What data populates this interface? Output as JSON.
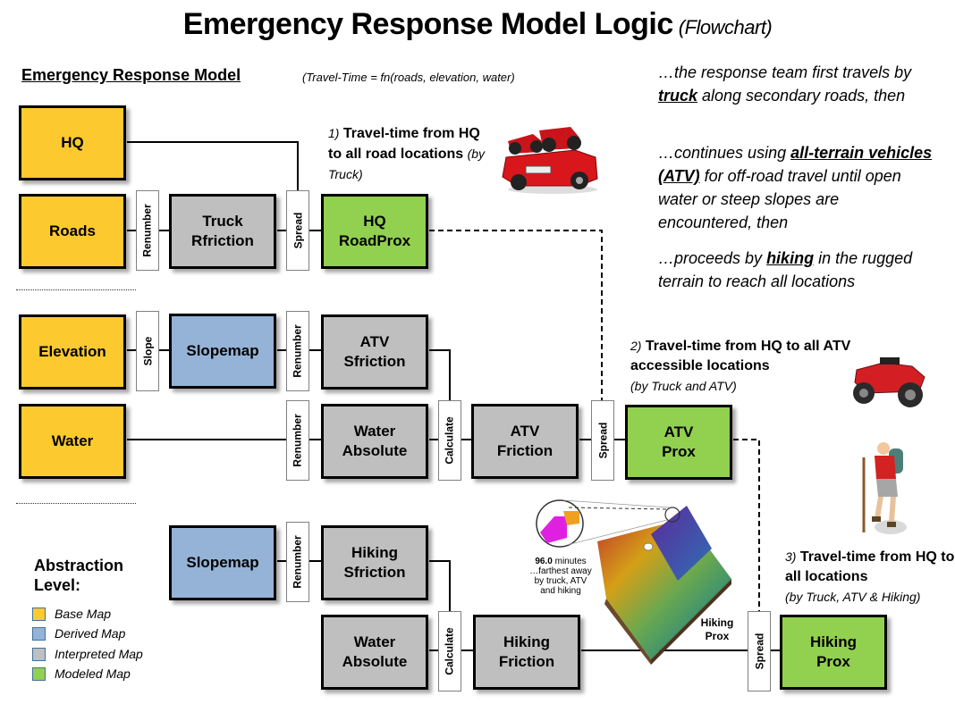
{
  "title": {
    "main": "Emergency Response Model Logic",
    "sub": "(Flowchart)"
  },
  "model": {
    "heading": "Emergency Response Model",
    "formula": "(Travel-Time = fn(roads, elevation, water)"
  },
  "colors": {
    "base": "#fcca2e",
    "derived": "#95b3d7",
    "interpreted": "#bfbfbf",
    "modeled": "#92d050"
  },
  "boxes": {
    "hq": "HQ",
    "roads": "Roads",
    "truck_rfriction": [
      "Truck",
      "Rfriction"
    ],
    "hq_roadprox": [
      "HQ",
      "RoadProx"
    ],
    "elevation": "Elevation",
    "slopemap_atv": "Slopemap",
    "atv_sfriction": [
      "ATV",
      "Sfriction"
    ],
    "water": "Water",
    "water_absolute_atv": [
      "Water",
      "Absolute"
    ],
    "atv_friction": [
      "ATV",
      "Friction"
    ],
    "atv_prox": [
      "ATV",
      "Prox"
    ],
    "slopemap_hiking": "Slopemap",
    "hiking_sfriction": [
      "Hiking",
      "Sfriction"
    ],
    "water_absolute_hiking": [
      "Water",
      "Absolute"
    ],
    "hiking_friction": [
      "Hiking",
      "Friction"
    ],
    "hiking_prox": [
      "Hiking",
      "Prox"
    ]
  },
  "operations": {
    "renumber_roads": "Renumber",
    "spread_truck": "Spread",
    "slope": "Slope",
    "renumber_slope_atv": "Renumber",
    "renumber_water_atv": "Renumber",
    "calculate_atv": "Calculate",
    "spread_atv": "Spread",
    "renumber_slope_hiking": "Renumber",
    "calculate_hiking": "Calculate",
    "spread_hiking": "Spread"
  },
  "narrative": {
    "p1": {
      "pre": "…the response team first travels by ",
      "bold": "truck",
      "post": " along secondary roads, then"
    },
    "p2": {
      "pre": "…continues using ",
      "bold": "all-terrain vehicles (ATV)",
      "post": " for off-road travel until open water or steep slopes are encountered, then"
    },
    "p3": {
      "pre": "…proceeds by ",
      "bold": "hiking",
      "post": " in the rugged terrain to reach all locations"
    }
  },
  "notes": {
    "n1": {
      "num": "1)",
      "text": "Travel-time from HQ to all road locations",
      "sub": "(by Truck)"
    },
    "n2": {
      "num": "2)",
      "text": "Travel-time from HQ to all ATV accessible locations",
      "sub": "(by Truck and ATV)"
    },
    "n3": {
      "num": "3)",
      "text": "Travel-time from HQ to all locations",
      "sub": "(by Truck, ATV & Hiking)"
    }
  },
  "terrain_inset": {
    "value": "96.0",
    "unit": "minutes",
    "caption": "…farthest away by truck, ATV and hiking",
    "label": "Hiking Prox"
  },
  "legend": {
    "title": "Abstraction Level:",
    "items": [
      {
        "label": "Base Map",
        "color": "#fcca2e"
      },
      {
        "label": "Derived Map",
        "color": "#95b3d7"
      },
      {
        "label": "Interpreted Map",
        "color": "#bfbfbf"
      },
      {
        "label": "Modeled Map",
        "color": "#92d050"
      }
    ]
  },
  "icons": [
    "truck-with-atvs-image",
    "atv-image",
    "hiker-image",
    "terrain-3d-map-image"
  ]
}
